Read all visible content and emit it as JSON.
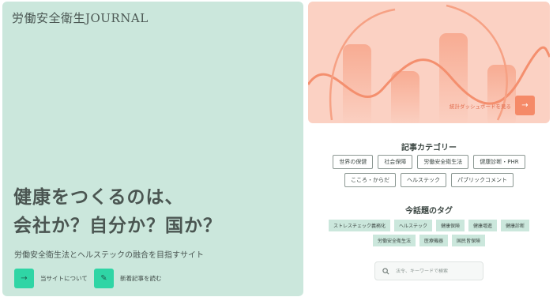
{
  "site": {
    "logo": "労働安全衛生JOURNAL"
  },
  "hero": {
    "headline_line1": "健康をつくるのは、",
    "headline_line2": "会社か？自分か？国か？",
    "subtitle": "労働安全衛生法とヘルステックの融合を目指すサイト",
    "about_label": "当サイトについて",
    "new_label": "新着記事を読む",
    "about_icon": "→",
    "new_icon": "✎"
  },
  "banner": {
    "link_text": "統計ダッシュボードを見る",
    "arrow": "→"
  },
  "categories": {
    "title": "記事カテゴリー",
    "row1": [
      "世界の保健",
      "社会保障",
      "労働安全衛生法",
      "健康診断・PHR"
    ],
    "row2": [
      "こころ・からだ",
      "ヘルステック",
      "パブリックコメント"
    ]
  },
  "tags": {
    "title": "今話題のタグ",
    "row1": [
      "ストレスチェック義務化",
      "ヘルステック",
      "健康保険",
      "健康増進",
      "健康診断"
    ],
    "row2": [
      "労働安全衛生法",
      "医療機器",
      "国民皆保険"
    ]
  },
  "search": {
    "placeholder": "法令、キーワードで検索"
  },
  "colors": {
    "hero_bg": "#cbe7dc",
    "accent_green": "#2fd5a5",
    "banner_bg": "#fbd1c3",
    "banner_accent": "#f58a68"
  }
}
